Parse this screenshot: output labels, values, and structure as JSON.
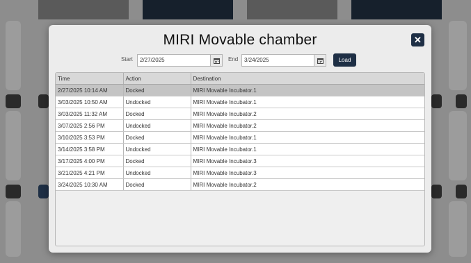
{
  "modal": {
    "title": "MIRI Movable chamber"
  },
  "filter": {
    "start_label": "Start",
    "start_value": "2/27/2025",
    "end_label": "End",
    "end_value": "3/24/2025",
    "load_label": "Load"
  },
  "table": {
    "columns": [
      "Time",
      "Action",
      "Destination"
    ],
    "rows": [
      [
        "2/27/2025 10:14 AM",
        "Docked",
        "MIRI Movable Incubator.1"
      ],
      [
        "3/03/2025 10:50 AM",
        "Undocked",
        "MIRI Movable Incubator.1"
      ],
      [
        "3/03/2025 11:32 AM",
        "Docked",
        "MIRI Movable Incubator.2"
      ],
      [
        "3/07/2025 2:56 PM",
        "Undocked",
        "MIRI Movable Incubator.2"
      ],
      [
        "3/10/2025 3:53 PM",
        "Docked",
        "MIRI Movable Incubator.1"
      ],
      [
        "3/14/2025 3:58 PM",
        "Undocked",
        "MIRI Movable Incubator.1"
      ],
      [
        "3/17/2025 4:00 PM",
        "Docked",
        "MIRI Movable Incubator.3"
      ],
      [
        "3/21/2025 4:21 PM",
        "Undocked",
        "MIRI Movable Incubator.3"
      ],
      [
        "3/24/2025 10:30 AM",
        "Docked",
        "MIRI Movable Incubator.2"
      ]
    ]
  },
  "icons": {
    "close": "close-icon",
    "calendar": "calendar-icon"
  },
  "colors": {
    "accent": "#1e2f45",
    "selected_row": "#c4c4c4",
    "modal_bg": "#ececec"
  }
}
